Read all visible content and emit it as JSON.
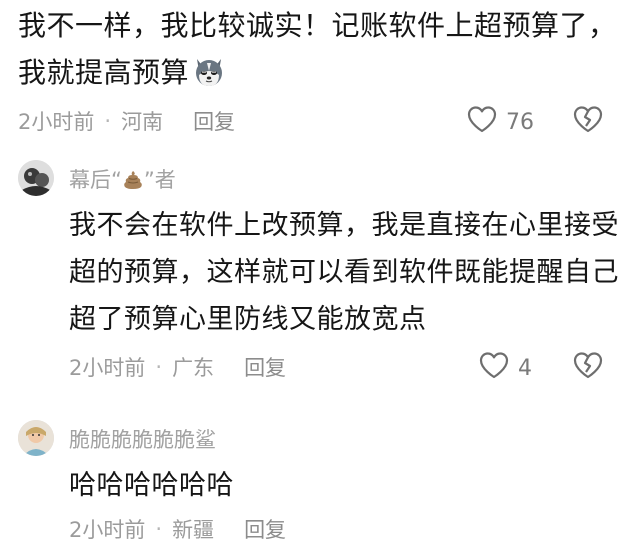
{
  "top_comment": {
    "text": "我不一样，我比较诚实！记账软件上超预算了，我就提高预算",
    "sticker_icon": "husky-dog-emoji",
    "time": "2小时前",
    "location": "河南",
    "reply_label": "回复",
    "like_count": "76"
  },
  "replies": [
    {
      "username_prefix": "幕后“",
      "username_icon": "poop-emoji",
      "username_suffix": "”者",
      "text": "我不会在软件上改预算，我是直接在心里接受超的预算，这样就可以看到软件既能提醒自己超了预算心里防线又能放宽点",
      "time": "2小时前",
      "location": "广东",
      "reply_label": "回复",
      "like_count": "4"
    },
    {
      "username": "脆脆脆脆脆脆鲨",
      "text": "哈哈哈哈哈哈",
      "time": "2小时前",
      "location": "新疆",
      "reply_label": "回复"
    }
  ],
  "meta_separator": "·",
  "colors": {
    "text_primary": "#161616",
    "text_meta": "#9b9b9b",
    "icon_stroke": "#6e6e6e"
  }
}
